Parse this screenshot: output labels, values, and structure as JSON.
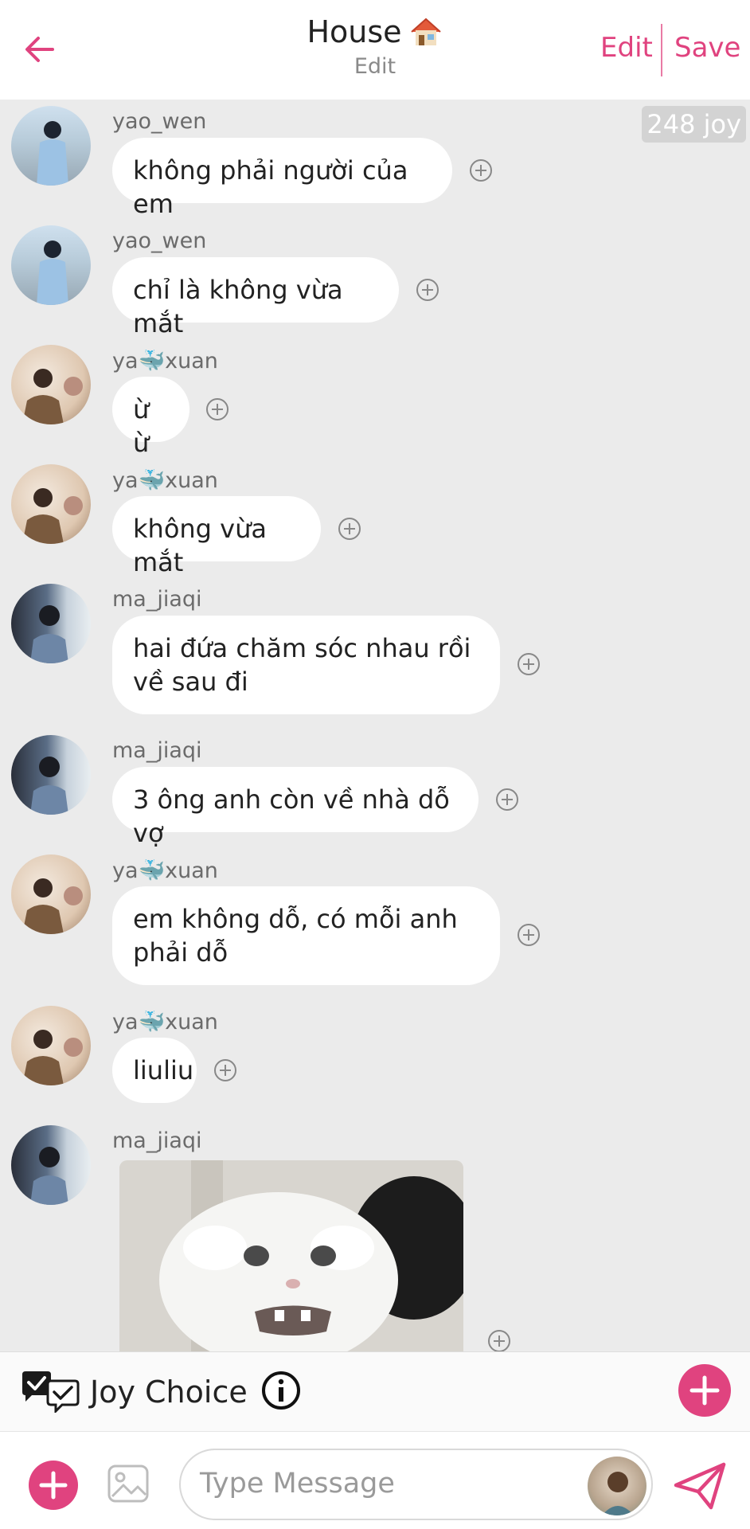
{
  "header": {
    "title": "House",
    "subtitle": "Edit",
    "edit_label": "Edit",
    "save_label": "Save"
  },
  "joy_balance": "248 joy",
  "messages": [
    {
      "sender": "yao_wen",
      "text": "không phải người của em"
    },
    {
      "sender": "yao_wen",
      "text": "chỉ là không vừa mắt"
    },
    {
      "sender": "ya🐳xuan",
      "text": "ừ ừ"
    },
    {
      "sender": "ya🐳xuan",
      "text": "không vừa mắt"
    },
    {
      "sender": "ma_jiaqi",
      "text": "hai đứa chăm sóc nhau rồi về sau đi"
    },
    {
      "sender": "ma_jiaqi",
      "text": "3 ông anh còn về nhà dỗ vợ"
    },
    {
      "sender": "ya🐳xuan",
      "text": "em không dỗ, có mỗi anh phải dỗ"
    },
    {
      "sender": "ya🐳xuan",
      "text": "liuliu"
    },
    {
      "sender": "ma_jiaqi",
      "text": ""
    }
  ],
  "joy_choice": {
    "label": "Joy Choice"
  },
  "input": {
    "placeholder": "Type Message"
  },
  "colors": {
    "accent": "#e0437f",
    "background": "#ebebeb",
    "bubble": "#ffffff"
  }
}
